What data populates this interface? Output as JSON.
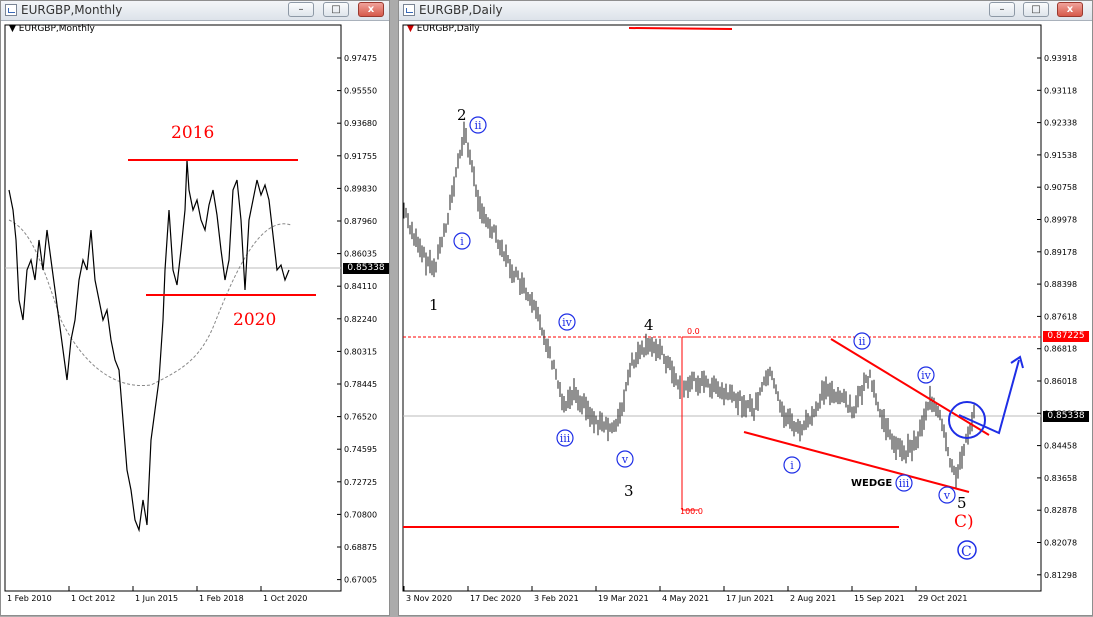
{
  "left_window": {
    "title": "EURGBP,Monthly",
    "symbol_label": "EURGBP,Monthly",
    "current_price": "0.85338",
    "price_labels": [
      "0.97475",
      "0.95550",
      "0.93680",
      "0.91755",
      "0.89830",
      "0.87960",
      "0.86035",
      "0.84110",
      "0.82240",
      "0.80315",
      "0.78445",
      "0.76520",
      "0.74595",
      "0.72725",
      "0.70800",
      "0.68875",
      "0.67005"
    ],
    "time_labels": [
      "1 Feb 2010",
      "1 Oct 2012",
      "1 Jun 2015",
      "1 Feb 2018",
      "1 Oct 2020"
    ],
    "annotations": {
      "top": "2016",
      "bottom": "2020"
    }
  },
  "right_window": {
    "title": "EURGBP,Daily",
    "symbol_label": "EURGBP,Daily",
    "current_price": "0.85338",
    "level_price": "0.87225",
    "price_labels": [
      "0.93918",
      "0.93118",
      "0.92338",
      "0.91538",
      "0.90758",
      "0.89978",
      "0.89178",
      "0.88398",
      "0.87618",
      "0.86818",
      "0.86018",
      "0.85238",
      "0.84458",
      "0.83658",
      "0.82878",
      "0.82078",
      "0.81298"
    ],
    "time_labels": [
      "3 Nov 2020",
      "17 Dec 2020",
      "3 Feb 2021",
      "19 Mar 2021",
      "4 May 2021",
      "17 Jun 2021",
      "2 Aug 2021",
      "15 Sep 2021",
      "29 Oct 2021"
    ],
    "fib": {
      "top": "0.0",
      "bottom": "100.0"
    },
    "waves": {
      "w1": "1",
      "w2": "2",
      "w3": "3",
      "w4": "4",
      "w5": "5",
      "wc": "C)",
      "wC": "C",
      "sub_i": "i",
      "sub_ii": "ii",
      "sub_iii": "iii",
      "sub_iv": "iv",
      "sub_v": "v"
    },
    "wedge_label": "WEDGE"
  },
  "window_buttons": {
    "minimize": "–",
    "maximize": "□",
    "close": "x"
  },
  "colors": {
    "annotation_red": "#ff0000",
    "wave_blue": "#1e2ee6",
    "price_box": "#000000",
    "level_box": "#ff0000"
  }
}
